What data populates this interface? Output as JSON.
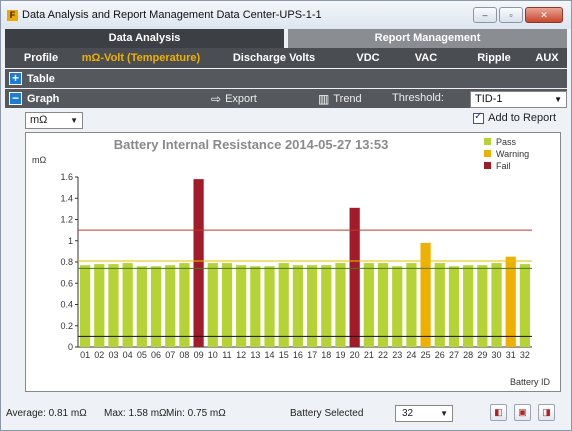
{
  "window": {
    "title": "Data Analysis and Report Management  Data Center-UPS-1-1",
    "logo": "F"
  },
  "main_tabs": [
    {
      "label": "Data Analysis"
    },
    {
      "label": "Report Management"
    }
  ],
  "sub_tabs": [
    {
      "label": "Profile"
    },
    {
      "label": "mΩ-Volt (Temperature)"
    },
    {
      "label": "Discharge Volts"
    },
    {
      "label": "VDC"
    },
    {
      "label": "VAC"
    },
    {
      "label": "Ripple"
    },
    {
      "label": "AUX"
    }
  ],
  "table_section": {
    "toggle": "+",
    "label": "Table"
  },
  "graph_section": {
    "toggle": "−",
    "label": "Graph",
    "export_label": "Export",
    "trend_label": "Trend",
    "threshold_label": "Threshold:",
    "threshold_value": "TID-1"
  },
  "unit_select": {
    "value": "mΩ"
  },
  "add_to_report": {
    "label": "Add to Report",
    "checked": true
  },
  "chart_data": {
    "type": "bar",
    "title": "Battery Internal Resistance 2014-05-27 13:53",
    "ylabel": "mΩ",
    "xlabel": "Battery ID",
    "ylim": [
      0,
      1.6
    ],
    "yticks": [
      "0",
      "0.2",
      "0.4",
      "0.6",
      "0.8",
      "1",
      "1.2",
      "1.4",
      "1.6"
    ],
    "categories": [
      "01",
      "02",
      "03",
      "04",
      "05",
      "06",
      "07",
      "08",
      "09",
      "10",
      "11",
      "12",
      "13",
      "14",
      "15",
      "16",
      "17",
      "18",
      "19",
      "20",
      "21",
      "22",
      "23",
      "24",
      "25",
      "26",
      "27",
      "28",
      "29",
      "30",
      "31",
      "32"
    ],
    "values": [
      0.77,
      0.78,
      0.78,
      0.79,
      0.76,
      0.76,
      0.77,
      0.79,
      1.58,
      0.79,
      0.79,
      0.77,
      0.76,
      0.76,
      0.79,
      0.77,
      0.77,
      0.77,
      0.79,
      1.31,
      0.79,
      0.79,
      0.76,
      0.79,
      0.98,
      0.79,
      0.76,
      0.77,
      0.77,
      0.79,
      0.85,
      0.78
    ],
    "status": [
      "pass",
      "pass",
      "pass",
      "pass",
      "pass",
      "pass",
      "pass",
      "pass",
      "fail",
      "pass",
      "pass",
      "pass",
      "pass",
      "pass",
      "pass",
      "pass",
      "pass",
      "pass",
      "pass",
      "fail",
      "pass",
      "pass",
      "pass",
      "pass",
      "warning",
      "pass",
      "pass",
      "pass",
      "pass",
      "pass",
      "warning",
      "pass"
    ],
    "threshold_lines": [
      {
        "value": 1.1,
        "color": "#c0392b"
      },
      {
        "value": 0.81,
        "color": "#e6c200"
      },
      {
        "value": 0.74,
        "color": "#4a7a1a"
      },
      {
        "value": 0.1,
        "color": "#111111"
      }
    ],
    "legend": [
      {
        "label": "Pass",
        "color": "#b5d334"
      },
      {
        "label": "Warning",
        "color": "#f0b000"
      },
      {
        "label": "Fail",
        "color": "#a11b2b"
      }
    ],
    "legend_position": "top-right",
    "colors": {
      "pass": "#b5d334",
      "warning": "#f0b000",
      "fail": "#a11b2b"
    }
  },
  "footer": {
    "average": "Average: 0.81 mΩ",
    "max": "Max: 1.58 mΩ",
    "min": "Min: 0.75 mΩ",
    "battery_selected_label": "Battery Selected",
    "battery_selected_value": "32"
  }
}
